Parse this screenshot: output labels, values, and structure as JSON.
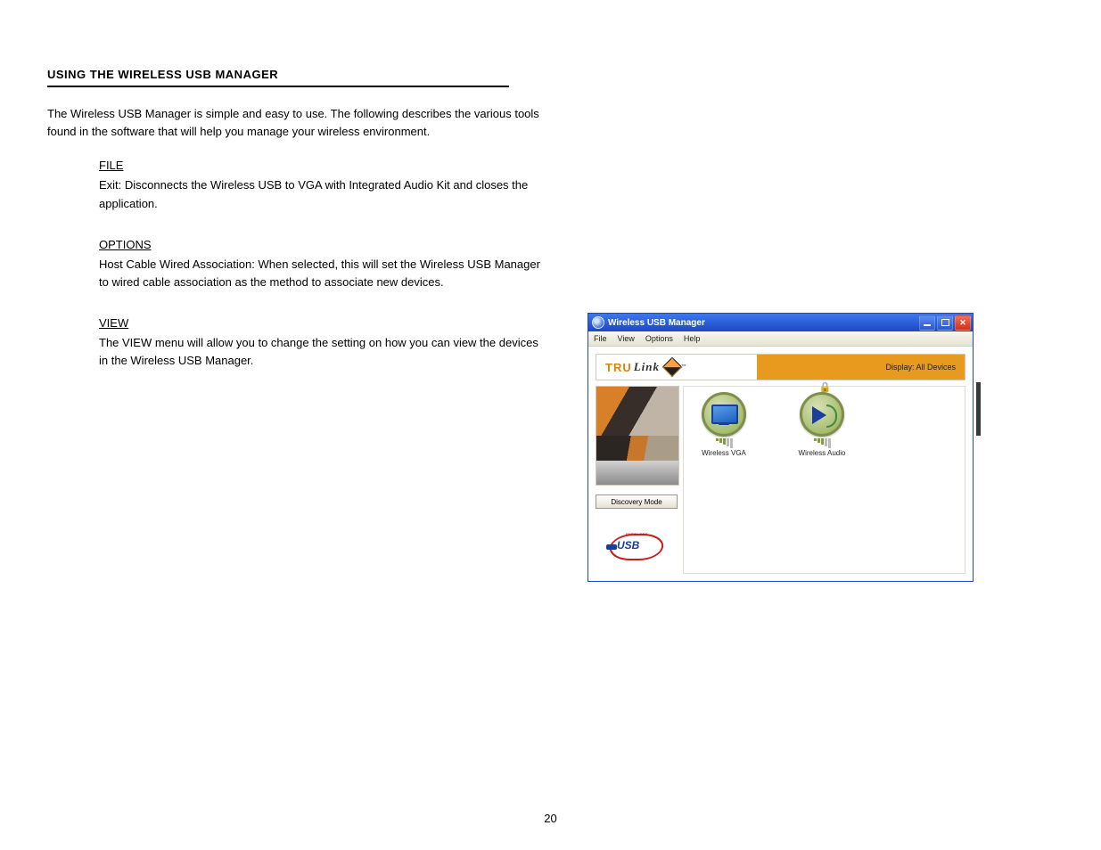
{
  "doc": {
    "section_heading": "USING THE WIRELESS USB MANAGER",
    "intro": "The Wireless USB Manager is simple and easy to use. The following describes the various tools found in the software that will help you manage your wireless environment.",
    "file_sub": "FILE",
    "file_desc": "Exit: Disconnects the Wireless USB to VGA with Integrated Audio Kit and closes the application.",
    "options_sub": "OPTIONS",
    "options_desc": "Host Cable Wired Association: When selected, this will set the Wireless USB Manager to wired cable association as the method to associate new devices.",
    "view_sub": "VIEW",
    "view_desc": "The VIEW menu will allow you to change the setting on how you can view the devices in the Wireless USB Manager.",
    "page_number": "20"
  },
  "window": {
    "title": "Wireless USB Manager",
    "menu": {
      "file": "File",
      "view": "View",
      "options": "Options",
      "help": "Help"
    },
    "brand_left": "TRU",
    "brand_right": "Link",
    "brand_tm": "™",
    "display_label": "Display: All Devices",
    "discovery_button": "Discovery Mode",
    "usb_brand_small": "WIRELESS",
    "usb_brand_big": "USB",
    "devices": [
      {
        "name": "Wireless VGA"
      },
      {
        "name": "Wireless Audio"
      }
    ]
  }
}
